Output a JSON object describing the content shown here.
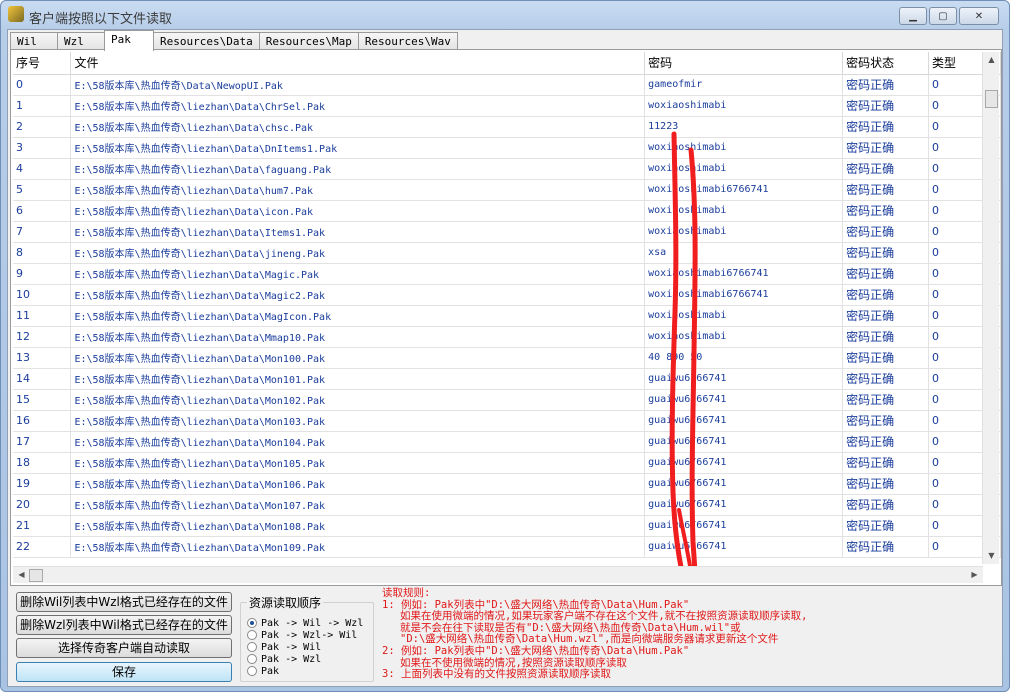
{
  "window": {
    "title": "客户端按照以下文件读取"
  },
  "tabs": [
    "Wil",
    "Wzl",
    "Pak",
    "Resources\\Data",
    "Resources\\Map",
    "Resources\\Wav"
  ],
  "active_tab": 2,
  "table": {
    "headers": [
      "序号",
      "文件",
      "密码",
      "密码状态",
      "类型"
    ],
    "rows": [
      [
        "0",
        "E:\\58版本库\\热血传奇\\Data\\NewopUI.Pak",
        "gameofmir",
        "密码正确",
        "0"
      ],
      [
        "1",
        "E:\\58版本库\\热血传奇\\liezhan\\Data\\ChrSel.Pak",
        "woxiaoshimabi",
        "密码正确",
        "0"
      ],
      [
        "2",
        "E:\\58版本库\\热血传奇\\liezhan\\Data\\chsc.Pak",
        "11223",
        "密码正确",
        "0"
      ],
      [
        "3",
        "E:\\58版本库\\热血传奇\\liezhan\\Data\\DnItems1.Pak",
        "woxiaoshimabi",
        "密码正确",
        "0"
      ],
      [
        "4",
        "E:\\58版本库\\热血传奇\\liezhan\\Data\\faguang.Pak",
        "woxiaoshimabi",
        "密码正确",
        "0"
      ],
      [
        "5",
        "E:\\58版本库\\热血传奇\\liezhan\\Data\\hum7.Pak",
        "woxiaoshimabi6766741",
        "密码正确",
        "0"
      ],
      [
        "6",
        "E:\\58版本库\\热血传奇\\liezhan\\Data\\icon.Pak",
        "woxiaoshimabi",
        "密码正确",
        "0"
      ],
      [
        "7",
        "E:\\58版本库\\热血传奇\\liezhan\\Data\\Items1.Pak",
        "woxiaoshimabi",
        "密码正确",
        "0"
      ],
      [
        "8",
        "E:\\58版本库\\热血传奇\\liezhan\\Data\\jineng.Pak",
        "xsa",
        "密码正确",
        "0"
      ],
      [
        "9",
        "E:\\58版本库\\热血传奇\\liezhan\\Data\\Magic.Pak",
        "woxiaoshimabi6766741",
        "密码正确",
        "0"
      ],
      [
        "10",
        "E:\\58版本库\\热血传奇\\liezhan\\Data\\Magic2.Pak",
        "woxiaoshimabi6766741",
        "密码正确",
        "0"
      ],
      [
        "11",
        "E:\\58版本库\\热血传奇\\liezhan\\Data\\MagIcon.Pak",
        "woxiaoshimabi",
        "密码正确",
        "0"
      ],
      [
        "12",
        "E:\\58版本库\\热血传奇\\liezhan\\Data\\Mmap10.Pak",
        "woxiaoshimabi",
        "密码正确",
        "0"
      ],
      [
        "13",
        "E:\\58版本库\\热血传奇\\liezhan\\Data\\Mon100.Pak",
        "40  890  50",
        "密码正确",
        "0"
      ],
      [
        "14",
        "E:\\58版本库\\热血传奇\\liezhan\\Data\\Mon101.Pak",
        "guaiwu6766741",
        "密码正确",
        "0"
      ],
      [
        "15",
        "E:\\58版本库\\热血传奇\\liezhan\\Data\\Mon102.Pak",
        "guaiwu6766741",
        "密码正确",
        "0"
      ],
      [
        "16",
        "E:\\58版本库\\热血传奇\\liezhan\\Data\\Mon103.Pak",
        "guaiwu6766741",
        "密码正确",
        "0"
      ],
      [
        "17",
        "E:\\58版本库\\热血传奇\\liezhan\\Data\\Mon104.Pak",
        "guaiwu6766741",
        "密码正确",
        "0"
      ],
      [
        "18",
        "E:\\58版本库\\热血传奇\\liezhan\\Data\\Mon105.Pak",
        "guaiwu6766741",
        "密码正确",
        "0"
      ],
      [
        "19",
        "E:\\58版本库\\热血传奇\\liezhan\\Data\\Mon106.Pak",
        "guaiwu6766741",
        "密码正确",
        "0"
      ],
      [
        "20",
        "E:\\58版本库\\热血传奇\\liezhan\\Data\\Mon107.Pak",
        "guaiwu6766741",
        "密码正确",
        "0"
      ],
      [
        "21",
        "E:\\58版本库\\热血传奇\\liezhan\\Data\\Mon108.Pak",
        "guaiwu6766741",
        "密码正确",
        "0"
      ],
      [
        "22",
        "E:\\58版本库\\热血传奇\\liezhan\\Data\\Mon109.Pak",
        "guaiwu6766741",
        "密码正确",
        "0"
      ]
    ]
  },
  "buttons": {
    "delete_wil": "删除Wil列表中Wzl格式已经存在的文件",
    "delete_wzl": "删除Wzl列表中Wil格式已经存在的文件",
    "choose_client": "选择传奇客户端自动读取",
    "save": "保存"
  },
  "read_order": {
    "title": "资源读取顺序",
    "options": [
      "Pak -> Wil -> Wzl",
      "Pak -> Wzl-> Wil",
      "Pak -> Wil",
      "Pak -> Wzl",
      "Pak"
    ],
    "selected": 0
  },
  "rules": {
    "heading": "读取规则:",
    "lines": [
      {
        "text": "1: 例如: Pak列表中\"D:\\盛大网络\\热血传奇\\Data\\Hum.Pak\"",
        "indent": false
      },
      {
        "text": "如果在使用微端的情况,如果玩家客户端不存在这个文件,就不在按照资源读取顺序读取,",
        "indent": true
      },
      {
        "text": "就是不会在往下读取是否有\"D:\\盛大网络\\热血传奇\\Data\\Hum.wil\"或",
        "indent": true
      },
      {
        "text": "\"D:\\盛大网络\\热血传奇\\Data\\Hum.wzl\",而是向微端服务器请求更新这个文件",
        "indent": true
      },
      {
        "text": "2: 例如: Pak列表中\"D:\\盛大网络\\热血传奇\\Data\\Hum.Pak\"",
        "indent": false
      },
      {
        "text": "如果在不使用微端的情况,按照资源读取顺序读取",
        "indent": true
      },
      {
        "text": "3: 上面列表中没有的文件按照资源读取顺序读取",
        "indent": false
      }
    ]
  },
  "colors": {
    "annotation_stroke": "#f01e1e",
    "cell_text": "#1a3d9c",
    "rules_text": "#e01818"
  }
}
